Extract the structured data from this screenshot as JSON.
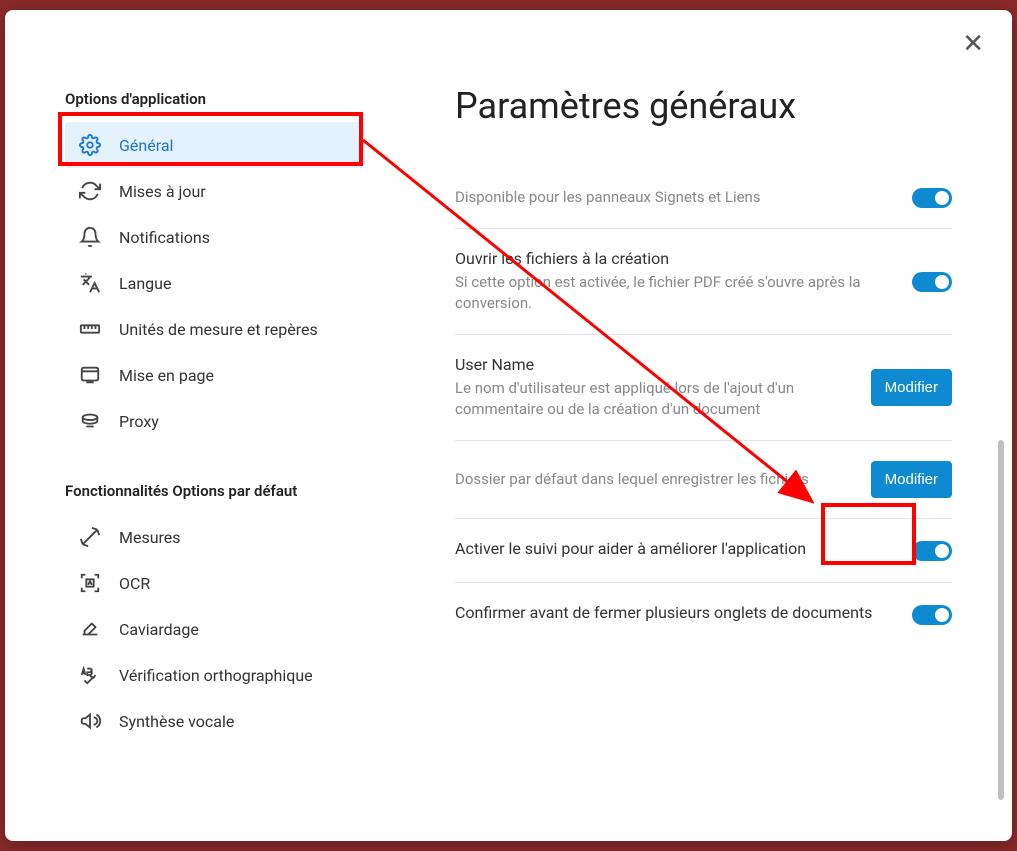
{
  "sidebar": {
    "section_app": "Options d'application",
    "section_features": "Fonctionnalités Options par défaut",
    "items": [
      {
        "label": "Général"
      },
      {
        "label": "Mises à jour"
      },
      {
        "label": "Notifications"
      },
      {
        "label": "Langue"
      },
      {
        "label": "Unités de mesure et repères"
      },
      {
        "label": "Mise en page"
      },
      {
        "label": "Proxy"
      }
    ],
    "feature_items": [
      {
        "label": "Mesures"
      },
      {
        "label": "OCR"
      },
      {
        "label": "Caviardage"
      },
      {
        "label": "Vérification orthographique"
      },
      {
        "label": "Synthèse vocale"
      }
    ]
  },
  "main": {
    "title": "Paramètres généraux",
    "settings": [
      {
        "desc": "Disponible pour les panneaux Signets et Liens"
      },
      {
        "title": "Ouvrir les fichiers à la création",
        "desc": "Si cette option est activée, le fichier PDF créé s'ouvre après la conversion."
      },
      {
        "title": "User Name",
        "desc": "Le nom d'utilisateur est appliqué lors de l'ajout d'un commentaire ou de la création d'un document",
        "btn": "Modifier"
      },
      {
        "desc": "Dossier par défaut dans lequel enregistrer les fichiers",
        "btn": "Modifier"
      },
      {
        "title": "Activer le suivi pour aider à améliorer l'application"
      },
      {
        "title": "Confirmer avant de fermer plusieurs onglets de documents"
      }
    ]
  }
}
